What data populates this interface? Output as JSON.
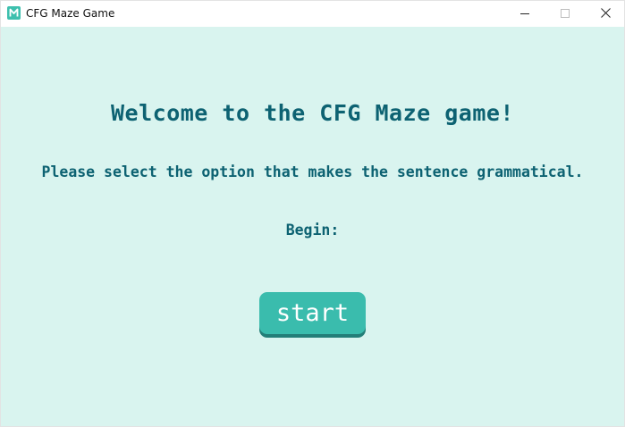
{
  "window": {
    "title": "CFG Maze Game",
    "icon": "maze-app-icon",
    "controls": {
      "minimize": "minimize-icon",
      "maximize": "maximize-icon",
      "close": "close-icon"
    }
  },
  "main": {
    "heading": "Welcome to the CFG Maze game!",
    "instructions": "Please select the option that makes the sentence grammatical.",
    "begin_label": "Begin:",
    "start_button": "start"
  },
  "colors": {
    "background": "#d9f4ef",
    "text": "#0d6272",
    "button": "#3abcad",
    "button_shadow": "#237e78",
    "button_text": "#ffffff"
  }
}
